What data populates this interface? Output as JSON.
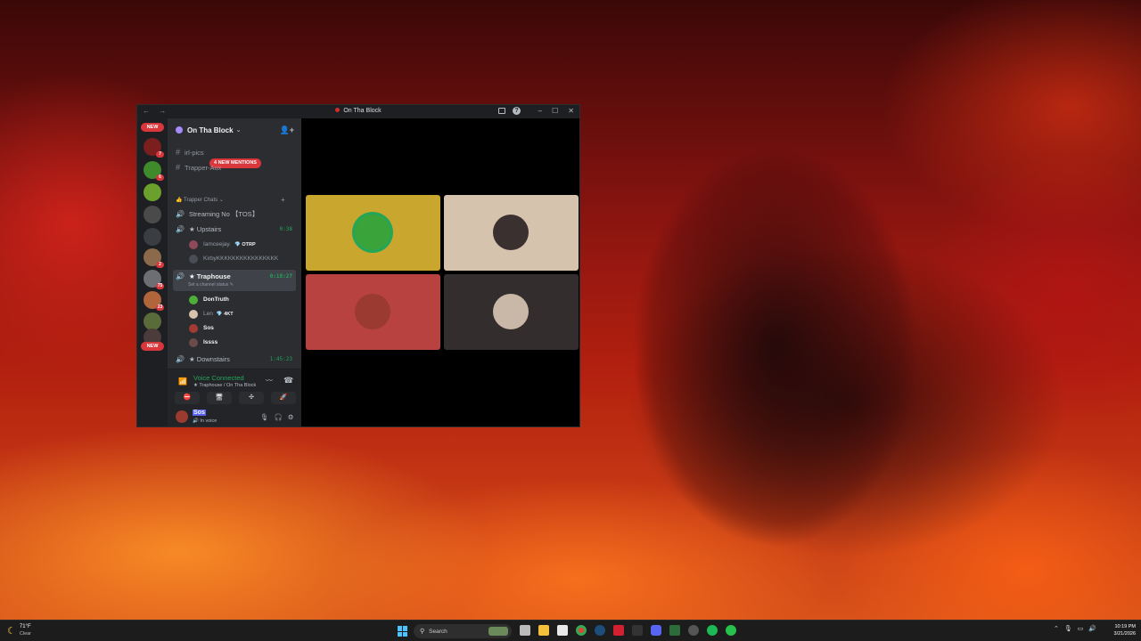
{
  "window": {
    "title": "On Tha Block",
    "nav_label": "← →",
    "controls": [
      "–",
      "☐",
      "✕"
    ]
  },
  "guild_bar": {
    "new_top_label": "NEW",
    "new_bottom_label": "NEW",
    "badges": [
      "7",
      "6",
      "2",
      "75",
      "23"
    ]
  },
  "server": {
    "name": "On Tha Block",
    "chevron": "⌄",
    "invite_icon": "👤+"
  },
  "channels": {
    "text": [
      {
        "name": "irl-pics"
      },
      {
        "name": "Trapper-Aux"
      }
    ],
    "mentions_pill": "4 NEW MENTIONS",
    "category": "Trapper Chats",
    "category_icon": "👍",
    "voice": [
      {
        "name": "Streaming No 【TOS】",
        "time": ""
      },
      {
        "name": "★ Upstairs",
        "time": "0:38"
      },
      {
        "name": "★ Traphouse",
        "time": "0:18:27",
        "sub": "Set a channel status ✎"
      },
      {
        "name": "★ Downstairs",
        "time": "1:45:23"
      }
    ],
    "upstairs_users": [
      {
        "name": "Iamceejay.",
        "tag": "💎 OTRP"
      },
      {
        "name": "KirbyKKKKKKKKKKKKKKKK",
        "tag": ""
      }
    ],
    "traphouse_users": [
      {
        "name": "DonTruth",
        "tag": ""
      },
      {
        "name": "Len",
        "tag": "💎 4KT"
      },
      {
        "name": "Sos",
        "tag": ""
      },
      {
        "name": "Issss",
        "tag": ""
      }
    ]
  },
  "voice_panel": {
    "status": "Voice Connected",
    "location": "★ Traphouse / On Tha Block",
    "buttons": [
      "⛔",
      "🖥",
      "✣",
      "🚀"
    ]
  },
  "user_panel": {
    "name": "Sos",
    "status": "🔊 In voice",
    "mic_icon": "🎙",
    "headset_icon": "🎧",
    "settings_icon": "⚙"
  },
  "tiles": [
    {
      "color": "#c9a62d",
      "speaking": true
    },
    {
      "color": "#d6c3ad",
      "speaking": false
    },
    {
      "color": "#b8423f",
      "speaking": false
    },
    {
      "color": "#332e2d",
      "speaking": false
    }
  ],
  "taskbar": {
    "weather_temp": "71°F",
    "weather_desc": "Clear",
    "search_placeholder": "Search",
    "time": "10:19 PM",
    "date": "3/21/2026"
  }
}
